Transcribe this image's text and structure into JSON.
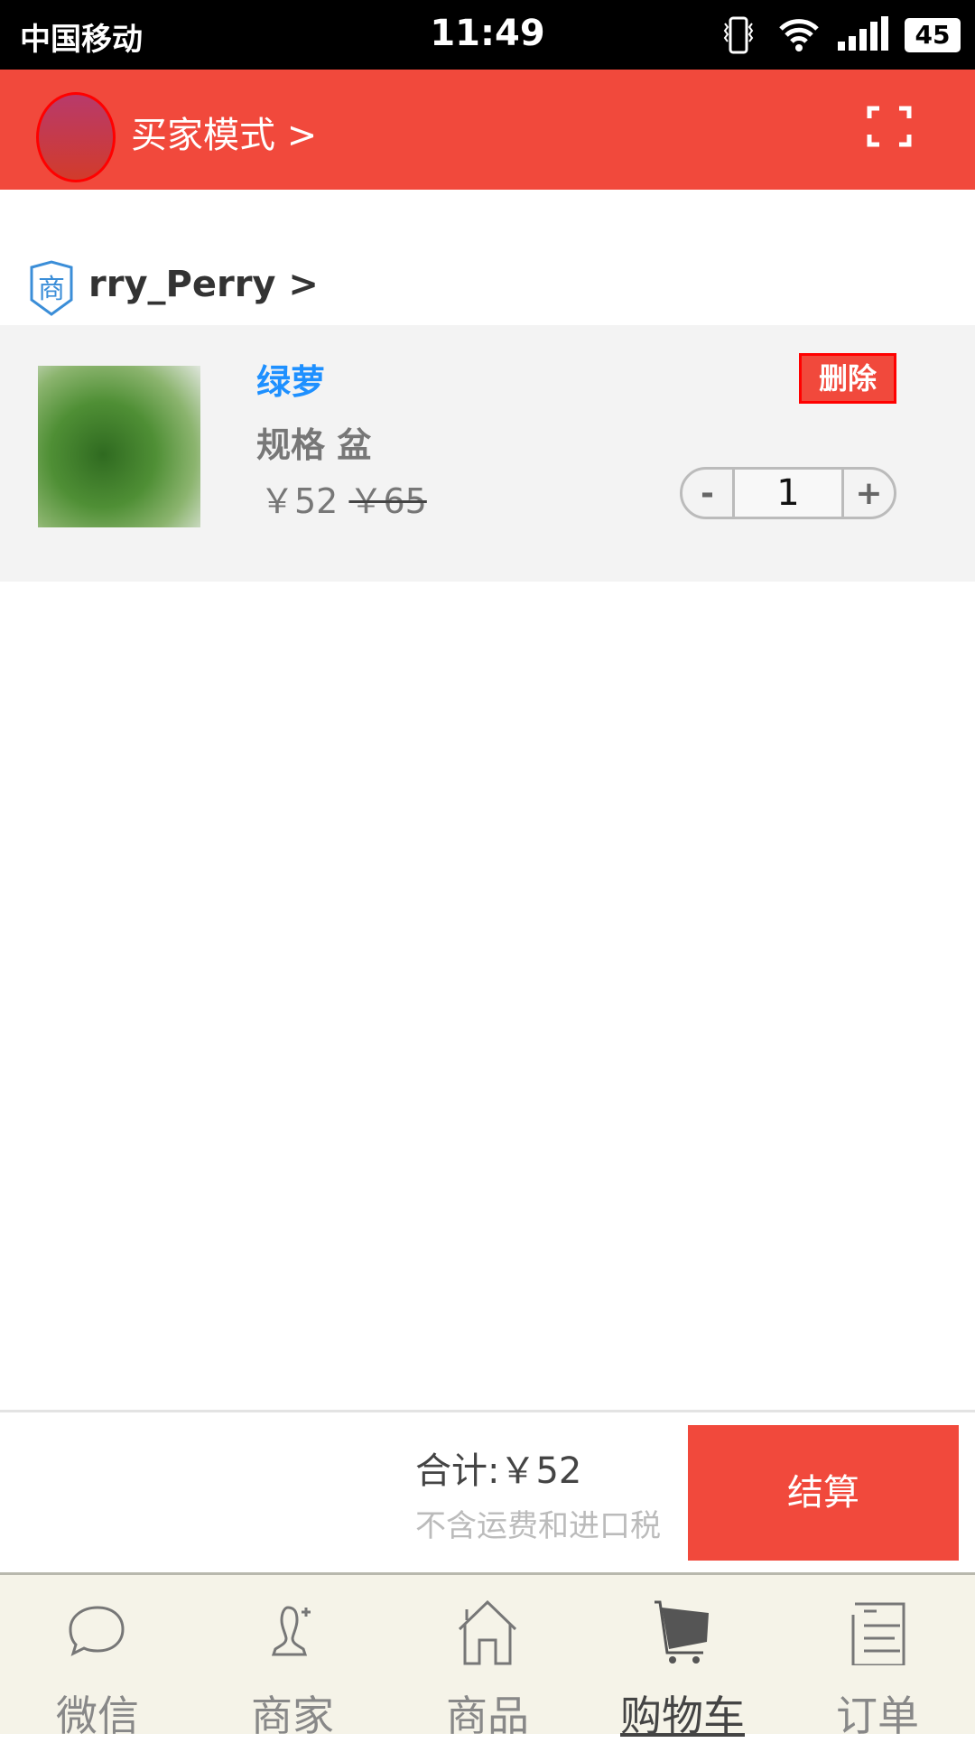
{
  "status_bar": {
    "carrier": "中国移动",
    "time": "11:49",
    "battery": "45",
    "icons": [
      "vibrate-icon",
      "wifi-icon",
      "signal-icon",
      "battery-icon"
    ]
  },
  "header": {
    "mode_label": "买家模式 >",
    "scan_icon": "scan-icon"
  },
  "shop": {
    "badge": "商",
    "name": "rry_Perry >"
  },
  "cart_item": {
    "name": "绿萝",
    "spec": "规格 盆",
    "price": "￥52",
    "original_price": "￥65",
    "delete_label": "删除",
    "quantity": "1",
    "minus": "-",
    "plus": "+"
  },
  "summary": {
    "total": "合计:￥52",
    "note": "不含运费和进口税",
    "checkout_label": "结算"
  },
  "tabs": [
    {
      "label": "微信",
      "icon": "chat-icon"
    },
    {
      "label": "商家",
      "icon": "merchant-icon"
    },
    {
      "label": "商品",
      "icon": "home-icon"
    },
    {
      "label": "购物车",
      "icon": "cart-icon",
      "active": true
    },
    {
      "label": "订单",
      "icon": "orders-icon"
    }
  ],
  "colors": {
    "accent": "#f1493c",
    "link": "#1e90ff",
    "tabbar_bg": "#f5f3e8"
  }
}
